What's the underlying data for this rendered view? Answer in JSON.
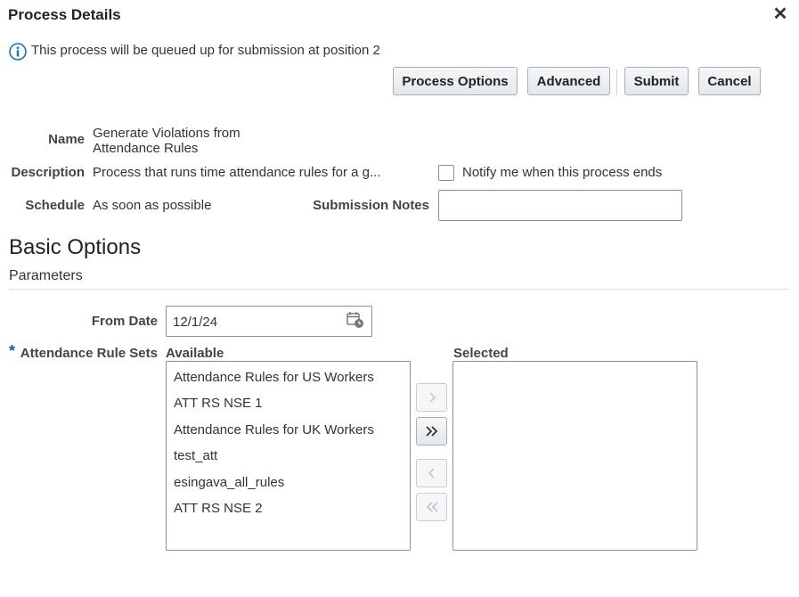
{
  "dialog": {
    "title": "Process Details",
    "info_message": "This process will be queued up for submission at position 2"
  },
  "toolbar": {
    "process_options_label": "Process Options",
    "advanced_label": "Advanced",
    "submit_label": "Submit",
    "cancel_label": "Cancel"
  },
  "details": {
    "name_label": "Name",
    "name_value_line1": "Generate Violations from",
    "name_value_line2": "Attendance Rules",
    "description_label": "Description",
    "description_value": "Process that runs time attendance rules for a g...",
    "notify_label": "Notify me when this process ends",
    "notify_checked": false,
    "schedule_label": "Schedule",
    "schedule_value": "As soon as possible",
    "submission_notes_label": "Submission Notes",
    "submission_notes_value": ""
  },
  "basic_options": {
    "title": "Basic Options",
    "parameters_label": "Parameters",
    "from_date_label": "From Date",
    "from_date_value": "12/1/24",
    "required_marker": "*",
    "rule_sets_label": "Attendance Rule Sets",
    "available_label": "Available",
    "selected_label": "Selected",
    "available_items": [
      "Attendance Rules for US Workers",
      "ATT RS NSE 1",
      "Attendance Rules for UK Workers",
      "test_att",
      "esingava_all_rules",
      "ATT RS NSE 2"
    ],
    "selected_items": []
  },
  "icons": {
    "info": "info-icon",
    "close": "close-icon",
    "calendar": "calendar-icon",
    "move": "chevron-right-icon",
    "move_all": "double-chevron-right-icon",
    "remove": "chevron-left-icon",
    "remove_all": "double-chevron-left-icon"
  },
  "colors": {
    "info_blue": "#1b6ec2",
    "required_blue": "#1b5aa8"
  }
}
